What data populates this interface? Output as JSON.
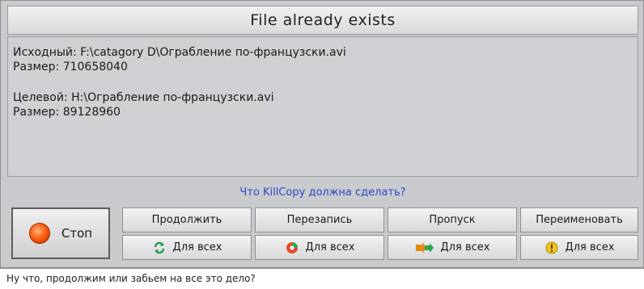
{
  "dialog": {
    "title": "File already exists",
    "source_line": "Исходный: F:\\catagory D\\Ограбление по-французски.avi",
    "source_size_line": "Размер: 710658040",
    "target_line": "Целевой: H:\\Ограбление по-французски.avi",
    "target_size_line": "Размер: 89128960",
    "question": "Что KillCopy должна сделать?"
  },
  "buttons": {
    "stop": "Стоп",
    "continue": "Продолжить",
    "overwrite": "Перезапись",
    "skip": "Пропуск",
    "rename": "Переименовать",
    "for_all": "Для всех"
  },
  "caption": "Ну что, продолжим или забьем на все это дело?",
  "icons": {
    "stop": "record-stop-icon",
    "continue": "refresh-arrows-icon",
    "overwrite": "overwrite-swirl-icon",
    "skip": "skip-arrows-icon",
    "rename": "warning-icon"
  },
  "colors": {
    "question_text": "#2b47c8",
    "stop_icon": "#ff6a1a"
  }
}
